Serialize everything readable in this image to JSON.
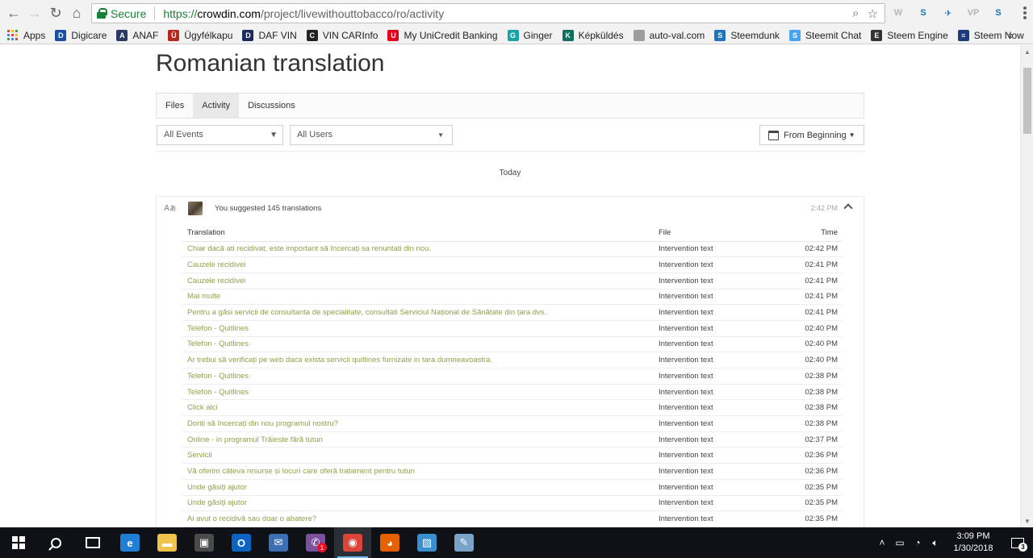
{
  "browser": {
    "secure_label": "Secure",
    "url_protocol": "https://",
    "url_host": "crowdin.com",
    "url_path": "/project/livewithouttobacco/ro/activity",
    "extensions": [
      "W",
      "S",
      "✈",
      "VP",
      "S"
    ],
    "bookmarks": [
      {
        "label": "Apps",
        "icon": "apps-grid-icon"
      },
      {
        "label": "Digicare",
        "icon": "digicare-icon",
        "color": "#1b4fa0",
        "glyph": "D"
      },
      {
        "label": "ANAF",
        "icon": "shield-icon",
        "color": "#2b3a67",
        "glyph": "A"
      },
      {
        "label": "Ügyfélkapu",
        "icon": "ugyfelkapu-icon",
        "color": "#b5281e",
        "glyph": "Ü"
      },
      {
        "label": "DAF VIN",
        "icon": "daf-icon",
        "color": "#1a2a5a",
        "glyph": "D"
      },
      {
        "label": "VIN CARInfo",
        "icon": "carinfo-icon",
        "color": "#222222",
        "glyph": "C"
      },
      {
        "label": "My UniCredit Banking",
        "icon": "unicredit-icon",
        "color": "#e2001a",
        "glyph": "U"
      },
      {
        "label": "Ginger",
        "icon": "ginger-icon",
        "color": "#1aa3a3",
        "glyph": "G"
      },
      {
        "label": "Képküldés",
        "icon": "kepkuldes-icon",
        "color": "#0e6f5c",
        "glyph": "K"
      },
      {
        "label": "auto-val.com",
        "icon": "page-icon",
        "color": "#9e9e9e",
        "glyph": ""
      },
      {
        "label": "Steemdunk",
        "icon": "steemdunk-icon",
        "color": "#1e73be",
        "glyph": "S"
      },
      {
        "label": "Steemit Chat",
        "icon": "steemit-icon",
        "color": "#4ba2f2",
        "glyph": "S"
      },
      {
        "label": "Steem Engine",
        "icon": "steem-engine-icon",
        "color": "#333333",
        "glyph": "E"
      },
      {
        "label": "Steem Now",
        "icon": "steem-now-icon",
        "color": "#1e3a7a",
        "glyph": "≡"
      }
    ],
    "more_bookmarks": "»"
  },
  "page": {
    "title": "Romanian translation",
    "tabs": [
      {
        "label": "Files",
        "active": false
      },
      {
        "label": "Activity",
        "active": true
      },
      {
        "label": "Discussions",
        "active": false
      }
    ],
    "filters": {
      "events": "All Events",
      "users": "All Users",
      "date": "From Beginning"
    },
    "day_label": "Today",
    "activity": {
      "summary": "You suggested 145 translations",
      "time": "2:42 PM",
      "columns": {
        "translation": "Translation",
        "file": "File",
        "time": "Time"
      },
      "rows": [
        {
          "text": "Chiar dacă ati recidivat, este important să încercați sa renuntati din nou.",
          "file": "Intervention text",
          "time": "02:42 PM"
        },
        {
          "text": "Cauzele recidivei",
          "file": "Intervention text",
          "time": "02:41 PM"
        },
        {
          "text": "Cauzele recidivei",
          "file": "Intervention text",
          "time": "02:41 PM"
        },
        {
          "text": "Mai multe",
          "file": "Intervention text",
          "time": "02:41 PM"
        },
        {
          "text": "Pentru a găsi servicii de consultanta de specialitate, consultati Serviciul Național de Sănătate din țara dvs.",
          "file": "Intervention text",
          "time": "02:41 PM"
        },
        {
          "text": "Telefon - Quitlines",
          "file": "Intervention text",
          "time": "02:40 PM"
        },
        {
          "text": "Telefon - Quitlines",
          "file": "Intervention text",
          "time": "02:40 PM"
        },
        {
          "text": "Ar trebui să verificați pe web daca exista servicii quitlines furnizate in tara dumneavoastra.",
          "file": "Intervention text",
          "time": "02:40 PM"
        },
        {
          "text": "Telefon - Quitlines",
          "file": "Intervention text",
          "time": "02:38 PM"
        },
        {
          "text": "Telefon - Quitlines",
          "file": "Intervention text",
          "time": "02:38 PM"
        },
        {
          "text": "Click aici",
          "file": "Intervention text",
          "time": "02:38 PM"
        },
        {
          "text": "Doriți să încercați din nou programul nostru?",
          "file": "Intervention text",
          "time": "02:38 PM"
        },
        {
          "text": "Online - in programul Trăieste fără tutun",
          "file": "Intervention text",
          "time": "02:37 PM"
        },
        {
          "text": "Servicii",
          "file": "Intervention text",
          "time": "02:36 PM"
        },
        {
          "text": "Vă oferim câteva resurse și locuri care oferă tratament pentru tutun",
          "file": "Intervention text",
          "time": "02:36 PM"
        },
        {
          "text": "Unde găsiți ajutor",
          "file": "Intervention text",
          "time": "02:35 PM"
        },
        {
          "text": "Unde găsiți ajutor",
          "file": "Intervention text",
          "time": "02:35 PM"
        },
        {
          "text": "Ai avut o recidivă sau doar o abatere?",
          "file": "Intervention text",
          "time": "02:35 PM"
        }
      ]
    }
  },
  "taskbar": {
    "apps": [
      {
        "name": "edge-icon",
        "glyph": "e",
        "color": "#1f7fd6"
      },
      {
        "name": "file-explorer-icon",
        "glyph": "▬",
        "color": "#f0c44b"
      },
      {
        "name": "store-icon",
        "glyph": "▣",
        "color": "#4a4a4a"
      },
      {
        "name": "outlook-icon",
        "glyph": "O",
        "color": "#0a64c2"
      },
      {
        "name": "thunderbird-icon",
        "glyph": "✉",
        "color": "#3d6fb4"
      },
      {
        "name": "viber-icon",
        "glyph": "✆",
        "color": "#7b519d",
        "badge": "1"
      },
      {
        "name": "chrome-icon",
        "glyph": "◉",
        "color": "#db4437",
        "active": true
      },
      {
        "name": "firefox-icon",
        "glyph": "◕",
        "color": "#e66000"
      },
      {
        "name": "photos-icon",
        "glyph": "▨",
        "color": "#3a8fd1"
      },
      {
        "name": "paint-icon",
        "glyph": "✎",
        "color": "#7aa3c9"
      }
    ],
    "time": "3:09 PM",
    "date": "1/30/2018",
    "notifications": "3"
  }
}
